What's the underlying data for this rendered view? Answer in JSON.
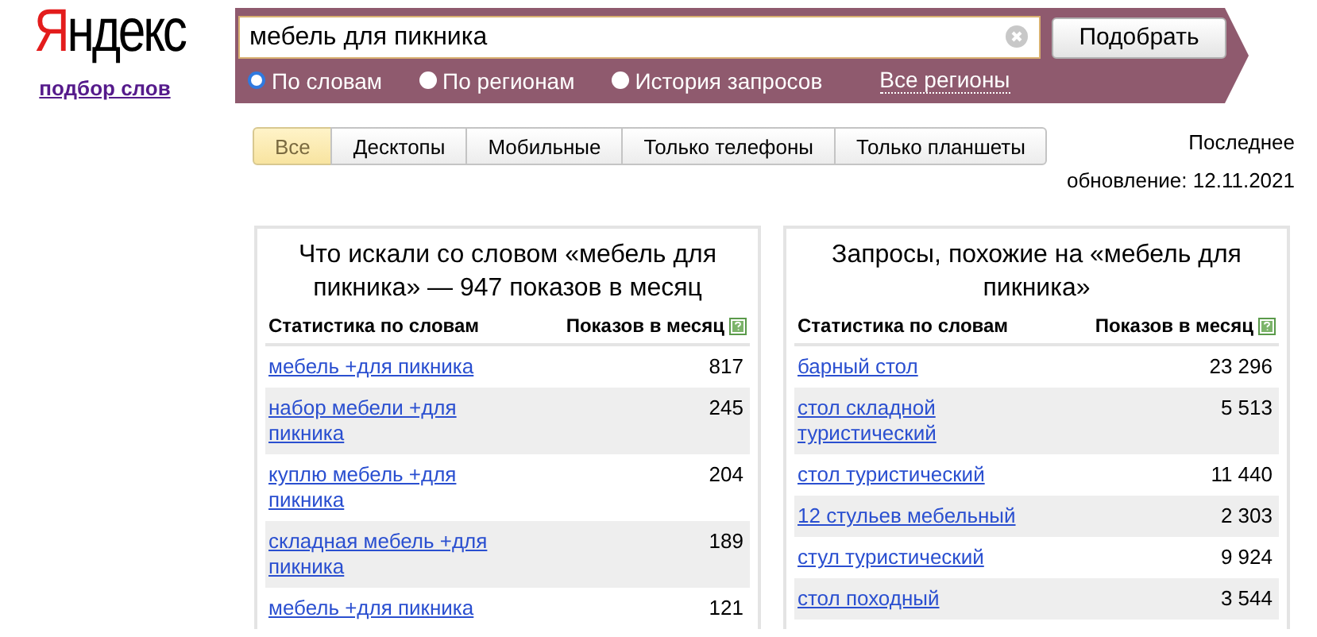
{
  "logo": {
    "first_letter": "Я",
    "rest": "ндекс"
  },
  "wordstat_link": "подбор слов",
  "search": {
    "value": "мебель для пикника",
    "button": "Подобрать"
  },
  "modes": [
    {
      "label": "По словам",
      "selected": true
    },
    {
      "label": "По регионам",
      "selected": false
    },
    {
      "label": "История запросов",
      "selected": false
    }
  ],
  "region_link": "Все регионы",
  "tabs": [
    {
      "label": "Все",
      "selected": true
    },
    {
      "label": "Десктопы",
      "selected": false
    },
    {
      "label": "Мобильные",
      "selected": false
    },
    {
      "label": "Только телефоны",
      "selected": false
    },
    {
      "label": "Только планшеты",
      "selected": false
    }
  ],
  "last_update": "Последнее обновление: 12.11.2021",
  "panels": [
    {
      "title": "Что искали со словом «мебель для пикника» — 947 показов в месяц",
      "columns": [
        "Статистика по словам",
        "Показов в месяц"
      ],
      "rows": [
        {
          "phrase": "мебель +для пикника",
          "count": "817"
        },
        {
          "phrase": "набор мебели +для пикника",
          "count": "245"
        },
        {
          "phrase": "куплю мебель +для пикника",
          "count": "204"
        },
        {
          "phrase": "складная мебель +для пикника",
          "count": "189"
        },
        {
          "phrase": "мебель +для пикника",
          "count": "121"
        }
      ]
    },
    {
      "title": "Запросы, похожие на «мебель для пикника»",
      "columns": [
        "Статистика по словам",
        "Показов в месяц"
      ],
      "rows": [
        {
          "phrase": "барный стол",
          "count": "23 296"
        },
        {
          "phrase": "стол складной туристический",
          "count": "5 513"
        },
        {
          "phrase": "стол туристический",
          "count": "11 440"
        },
        {
          "phrase": "12 стульев мебельный",
          "count": "2 303"
        },
        {
          "phrase": "стул туристический",
          "count": "9 924"
        },
        {
          "phrase": "стол походный",
          "count": "3 544"
        }
      ]
    }
  ]
}
